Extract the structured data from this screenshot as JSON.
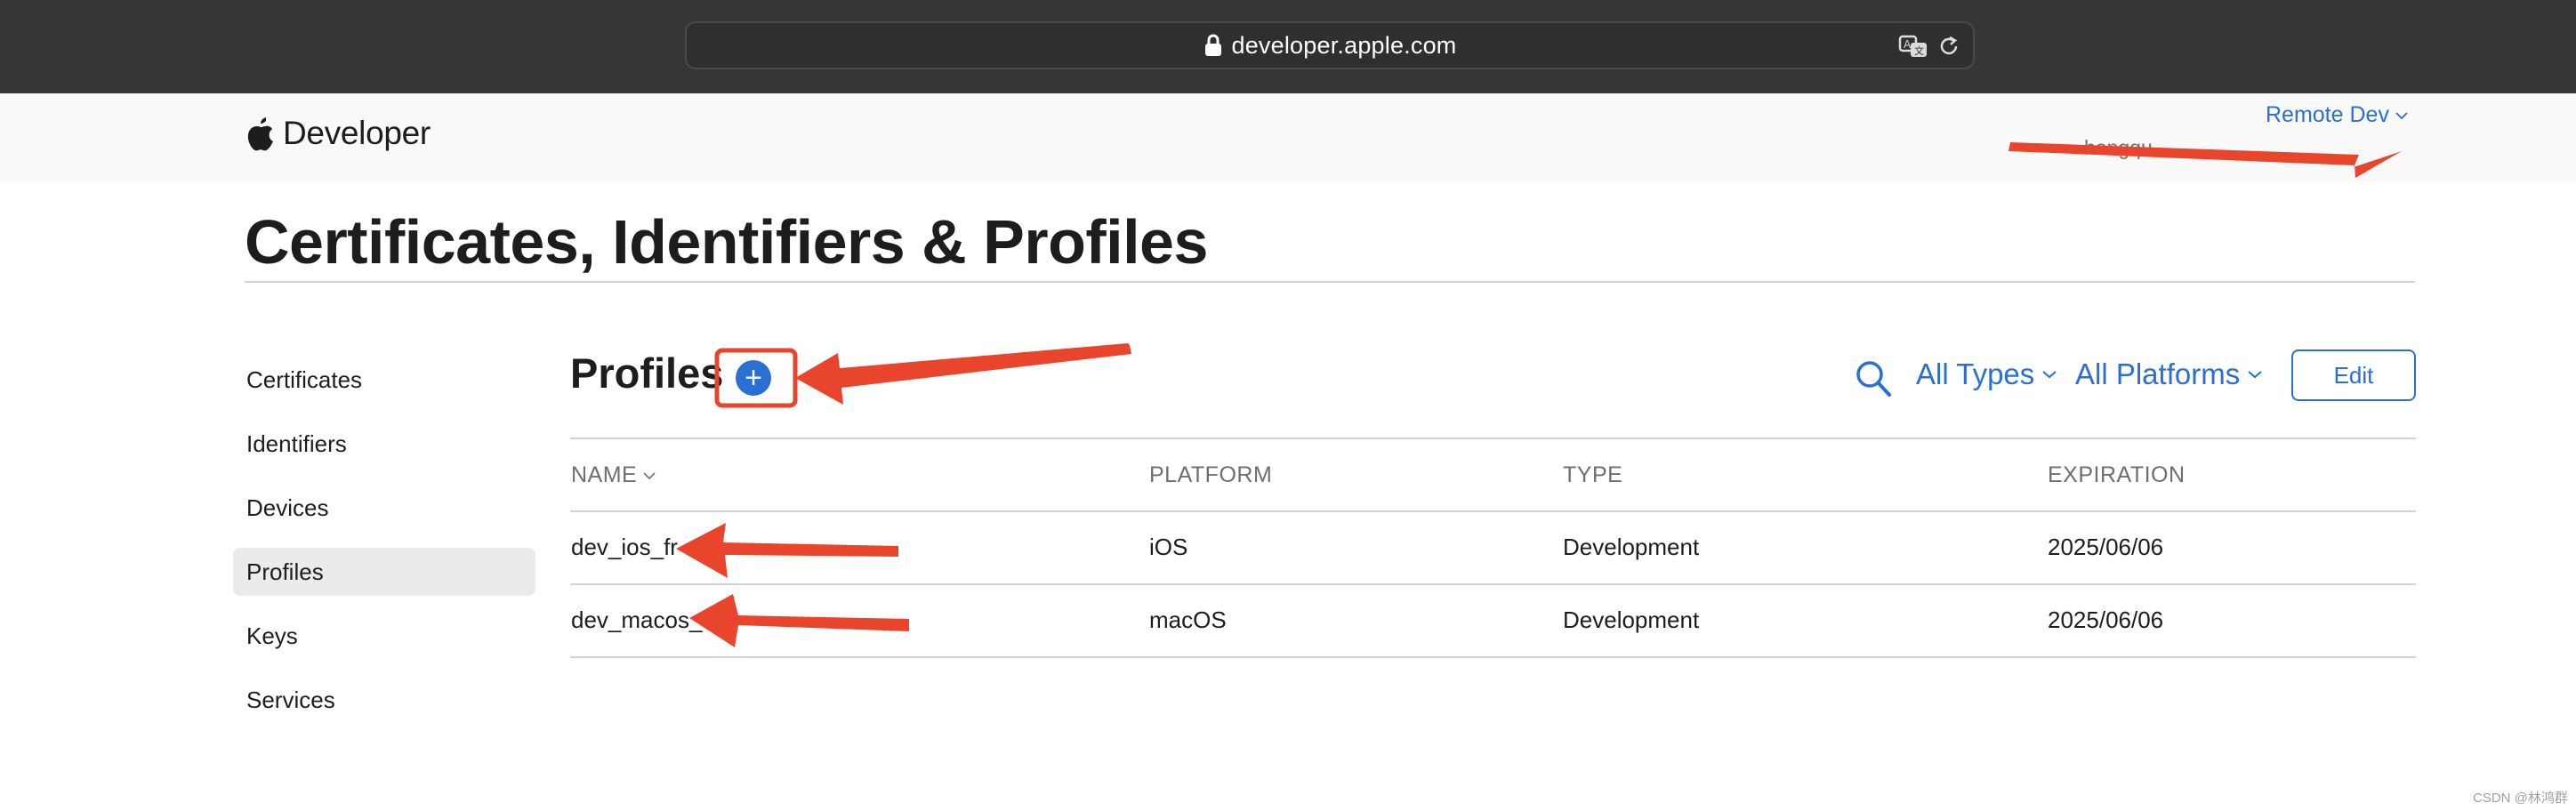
{
  "browser": {
    "url": "developer.apple.com"
  },
  "nav": {
    "brand": "Developer",
    "account_name": "Remote Dev",
    "account_sub": "hongqu..."
  },
  "page": {
    "title": "Certificates, Identifiers & Profiles"
  },
  "sidebar": {
    "items": [
      {
        "label": "Certificates"
      },
      {
        "label": "Identifiers"
      },
      {
        "label": "Devices"
      },
      {
        "label": "Profiles",
        "active": true
      },
      {
        "label": "Keys"
      },
      {
        "label": "Services"
      }
    ]
  },
  "section": {
    "title": "Profiles",
    "add_glyph": "+",
    "filter_types": "All Types",
    "filter_platforms": "All Platforms",
    "edit_label": "Edit"
  },
  "table": {
    "columns": [
      "NAME",
      "PLATFORM",
      "TYPE",
      "EXPIRATION"
    ],
    "rows": [
      {
        "name": "dev_ios_fr",
        "platform": "iOS",
        "type": "Development",
        "expiration": "2025/06/06"
      },
      {
        "name": "dev_macos_",
        "platform": "macOS",
        "type": "Development",
        "expiration": "2025/06/06"
      }
    ]
  },
  "footer": {
    "watermark": "CSDN @林鸿群"
  },
  "colors": {
    "accent": "#2a6fd3",
    "annotation": "#e8452c",
    "chrome": "#363636"
  }
}
